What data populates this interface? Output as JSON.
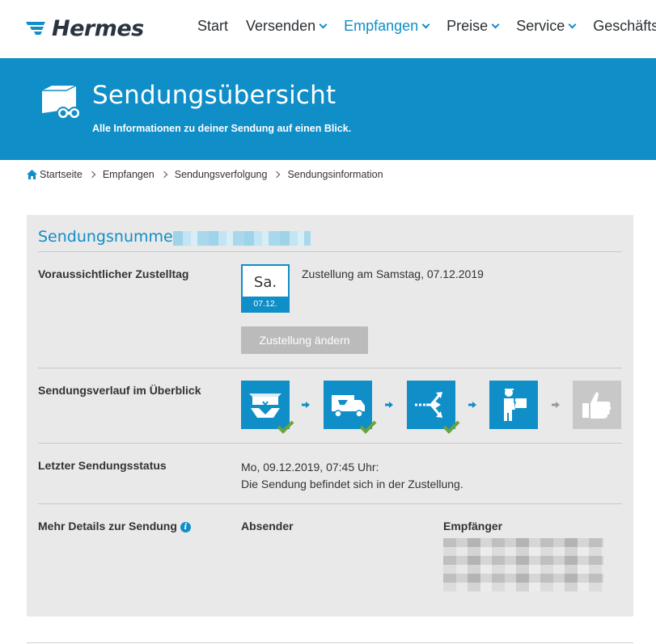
{
  "brand": {
    "name": "Hermes",
    "accent": "#0f8ec7",
    "text_dark": "#2a3440"
  },
  "nav": [
    {
      "label": "Start",
      "active": false,
      "dropdown": false
    },
    {
      "label": "Versenden",
      "active": false,
      "dropdown": true
    },
    {
      "label": "Empfangen",
      "active": true,
      "dropdown": true
    },
    {
      "label": "Preise",
      "active": false,
      "dropdown": true
    },
    {
      "label": "Service",
      "active": false,
      "dropdown": true
    },
    {
      "label": "Geschäftsk",
      "active": false,
      "dropdown": false
    }
  ],
  "hero": {
    "title": "Sendungsübersicht",
    "subtitle": "Alle Informationen zu deiner Sendung auf einen Blick.",
    "icon": "parcel-binoculars-icon"
  },
  "breadcrumb": [
    "Startseite",
    "Empfangen",
    "Sendungsverfolgung",
    "Sendungsinformation"
  ],
  "shipment": {
    "number_label": "Sendungsnummer",
    "delivery_day_label": "Voraussichtlicher Zustelltag",
    "day_short": "Sa.",
    "date_short": "07.12.",
    "delivery_text": "Zustellung am Samstag, 07.12.2019",
    "change_button": "Zustellung ändern",
    "history_label": "Sendungsverlauf im Überblick",
    "steps": [
      {
        "icon": "parcel-handover-icon",
        "done": true
      },
      {
        "icon": "delivery-truck-icon",
        "done": true
      },
      {
        "icon": "sorting-center-icon",
        "done": true
      },
      {
        "icon": "courier-icon",
        "done": false
      },
      {
        "icon": "thumbs-up-icon",
        "done": false
      }
    ],
    "last_status_label": "Letzter Sendungsstatus",
    "last_status_time": "Mo, 09.12.2019, 07:45 Uhr:",
    "last_status_text": "Die Sendung befindet sich in der Zustellung.",
    "details_label": "Mehr Details zur Sendung",
    "sender_label": "Absender",
    "recipient_label": "Empfänger"
  }
}
